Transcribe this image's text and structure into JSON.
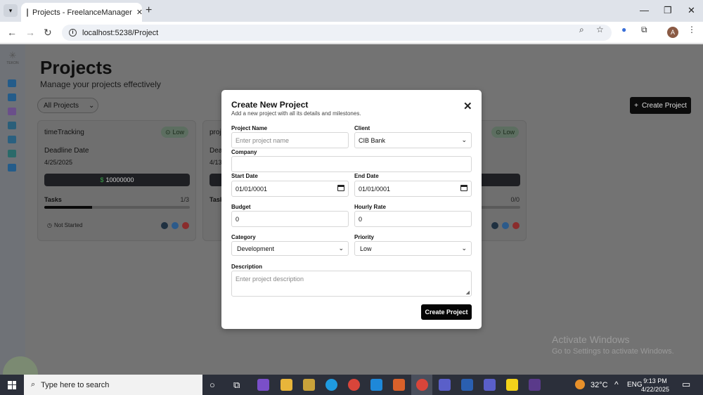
{
  "browser": {
    "tab_title": "Projects - FreelanceManager",
    "url": "localhost:5238/Project",
    "profile_initial": "A"
  },
  "sidebar": {
    "logo_text": "TEKON"
  },
  "page": {
    "title": "Projects",
    "subtitle": "Manage your projects effectively",
    "filter_value": "All Projects",
    "create_button": "Create Project"
  },
  "cards": [
    {
      "name": "timeTracking",
      "priority": "Low",
      "deadline_label": "Deadline Date",
      "deadline": "4/25/2025",
      "budget": "10000000",
      "tasks_label": "Tasks",
      "tasks_count": "1/3",
      "progress": 0.33,
      "status": "Not Started"
    },
    {
      "name": "proje",
      "deadline_label": "Dead",
      "deadline": "4/13,",
      "tasks_label": "Task"
    },
    {
      "priority": "Low",
      "tasks_count": "0/0",
      "progress": 0
    }
  ],
  "modal": {
    "title": "Create New Project",
    "description": "Add a new project with all its details and milestones.",
    "project_name_label": "Project Name",
    "project_name_placeholder": "Enter project name",
    "client_label": "Client",
    "client_value": "CIB Bank",
    "company_label": "Company",
    "company_value": "",
    "start_date_label": "Start Date",
    "start_date_value": "01/01/0001",
    "end_date_label": "End Date",
    "end_date_value": "01/01/0001",
    "budget_label": "Budget",
    "budget_value": "0",
    "hourly_rate_label": "Hourly Rate",
    "hourly_rate_value": "0",
    "category_label": "Category",
    "category_value": "Development",
    "priority_label": "Priority",
    "priority_value": "Low",
    "description_label": "Description",
    "description_placeholder": "Enter project description",
    "submit_label": "Create Project"
  },
  "watermark": {
    "title": "Activate Windows",
    "subtitle": "Go to Settings to activate Windows."
  },
  "taskbar": {
    "search_placeholder": "Type here to search",
    "temperature": "32°C",
    "language": "ENG",
    "time": "9:13 PM",
    "date": "4/22/2025"
  },
  "colors": {
    "accent": "#0c0c0c",
    "overlay": "#737373",
    "success": "#3aa04a"
  }
}
